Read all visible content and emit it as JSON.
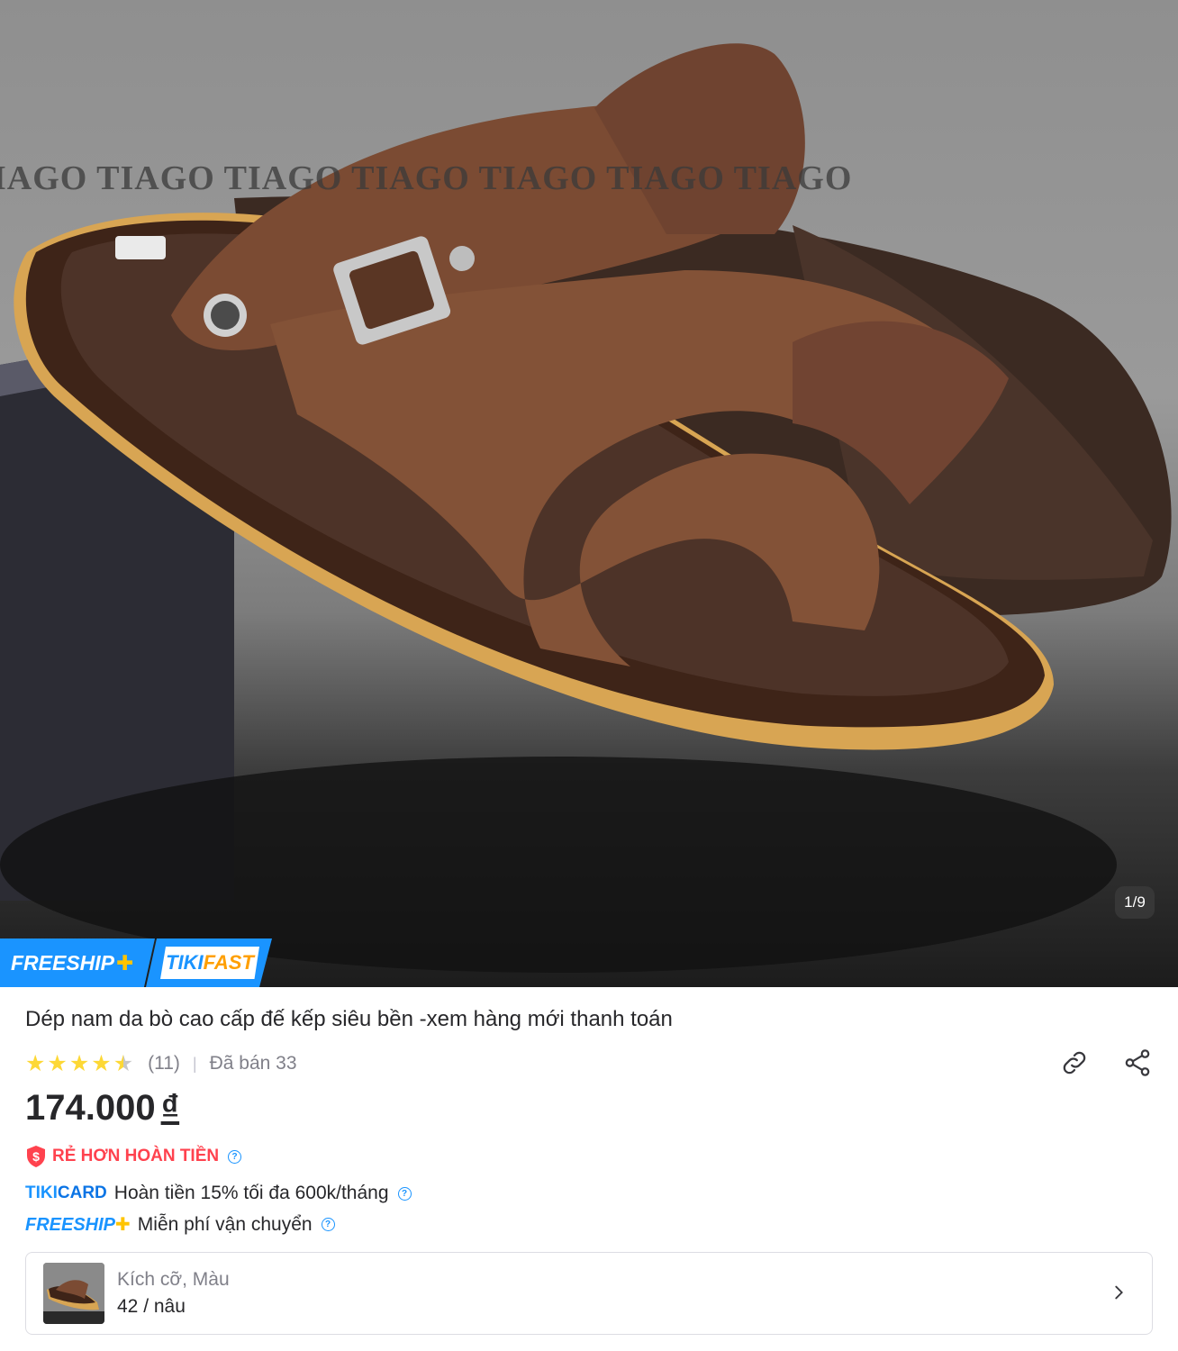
{
  "product": {
    "watermark": "IAGO TIAGO  TIAGO TIAGO TIAGO TIAGO TIAGO",
    "image_counter": "1/9",
    "badges": {
      "freeship": "FREESHIP",
      "plus": "✚",
      "tiki": "TIKI",
      "fast": "FAST"
    },
    "title": "Dép nam da bò cao cấp đế kếp siêu bền -xem hàng mới thanh toán",
    "rating": {
      "stars": 4.5,
      "count": "(11)",
      "sold": "Đã bán 33"
    },
    "price": {
      "amount": "174.000",
      "currency": "₫"
    },
    "promotions": {
      "cheaper": "RẺ HƠN HOÀN TIỀN",
      "tikicard_brand_a": "TIKI",
      "tikicard_brand_b": "CARD",
      "tikicard_text": "Hoàn tiền 15% tối đa 600k/tháng",
      "freeship_brand": "FREESHIP",
      "freeship_text": "Miễn phí vận chuyển"
    },
    "variant": {
      "label": "Kích cỡ, Màu",
      "value": "42 / nâu"
    }
  },
  "icons": [
    "link-icon",
    "share-icon",
    "star-icon",
    "help-circle-icon",
    "shield-dollar-icon",
    "chevron-right-icon"
  ],
  "colors": {
    "accent": "#1a94ff",
    "badge_yellow": "#ffc400",
    "promo_red": "#ff424e",
    "star": "#fdd836"
  }
}
